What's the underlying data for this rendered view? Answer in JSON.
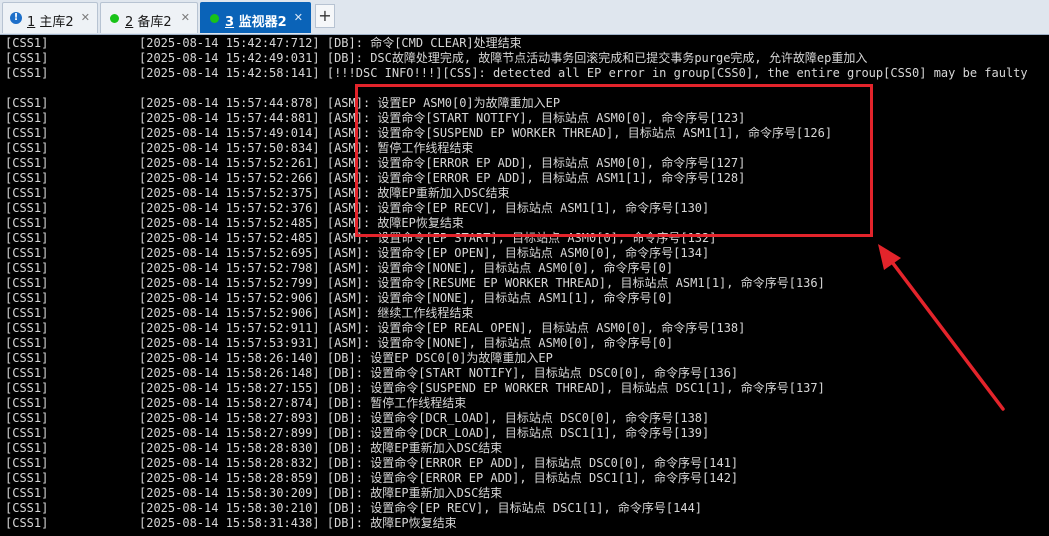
{
  "tabs": [
    {
      "number": "1",
      "title": "主库2",
      "status": "warn",
      "close": "✕"
    },
    {
      "number": "2",
      "title": "备库2",
      "status": "ok",
      "close": "✕"
    },
    {
      "number": "3",
      "title": "监视器2",
      "status": "ok",
      "close": "✕",
      "active": true
    }
  ],
  "new_tab_label": "+",
  "colors": {
    "active_tab": "#0a63b8",
    "status_ok": "#19c319",
    "annotation": "#e3242b"
  },
  "log_lines": [
    {
      "src": "[CSS1]",
      "msg": "[2025-08-14 15:42:47:712] [DB]: 命令[CMD CLEAR]处理结束"
    },
    {
      "src": "[CSS1]",
      "msg": "[2025-08-14 15:42:49:031] [DB]: DSC故障处理完成, 故障节点活动事务回滚完成和已提交事务purge完成, 允许故障ep重加入"
    },
    {
      "src": "[CSS1]",
      "msg": "[2025-08-14 15:42:58:141] [!!!DSC INFO!!!][CSS]: detected all EP error in group[CSS0], the entire group[CSS0] may be faulty"
    },
    {
      "src": "",
      "msg": ""
    },
    {
      "src": "[CSS1]",
      "msg": "[2025-08-14 15:57:44:878] [ASM]: 设置EP ASM0[0]为故障重加入EP"
    },
    {
      "src": "[CSS1]",
      "msg": "[2025-08-14 15:57:44:881] [ASM]: 设置命令[START NOTIFY], 目标站点 ASM0[0], 命令序号[123]"
    },
    {
      "src": "[CSS1]",
      "msg": "[2025-08-14 15:57:49:014] [ASM]: 设置命令[SUSPEND EP WORKER THREAD], 目标站点 ASM1[1], 命令序号[126]"
    },
    {
      "src": "[CSS1]",
      "msg": "[2025-08-14 15:57:50:834] [ASM]: 暂停工作线程结束"
    },
    {
      "src": "[CSS1]",
      "msg": "[2025-08-14 15:57:52:261] [ASM]: 设置命令[ERROR EP ADD], 目标站点 ASM0[0], 命令序号[127]"
    },
    {
      "src": "[CSS1]",
      "msg": "[2025-08-14 15:57:52:266] [ASM]: 设置命令[ERROR EP ADD], 目标站点 ASM1[1], 命令序号[128]"
    },
    {
      "src": "[CSS1]",
      "msg": "[2025-08-14 15:57:52:375] [ASM]: 故障EP重新加入DSC结束"
    },
    {
      "src": "[CSS1]",
      "msg": "[2025-08-14 15:57:52:376] [ASM]: 设置命令[EP RECV], 目标站点 ASM1[1], 命令序号[130]"
    },
    {
      "src": "[CSS1]",
      "msg": "[2025-08-14 15:57:52:485] [ASM]: 故障EP恢复结束"
    },
    {
      "src": "[CSS1]",
      "msg": "[2025-08-14 15:57:52:485] [ASM]: 设置命令[EP START], 目标站点 ASM0[0], 命令序号[132]"
    },
    {
      "src": "[CSS1]",
      "msg": "[2025-08-14 15:57:52:695] [ASM]: 设置命令[EP OPEN], 目标站点 ASM0[0], 命令序号[134]"
    },
    {
      "src": "[CSS1]",
      "msg": "[2025-08-14 15:57:52:798] [ASM]: 设置命令[NONE], 目标站点 ASM0[0], 命令序号[0]"
    },
    {
      "src": "[CSS1]",
      "msg": "[2025-08-14 15:57:52:799] [ASM]: 设置命令[RESUME EP WORKER THREAD], 目标站点 ASM1[1], 命令序号[136]"
    },
    {
      "src": "[CSS1]",
      "msg": "[2025-08-14 15:57:52:906] [ASM]: 设置命令[NONE], 目标站点 ASM1[1], 命令序号[0]"
    },
    {
      "src": "[CSS1]",
      "msg": "[2025-08-14 15:57:52:906] [ASM]: 继续工作线程结束"
    },
    {
      "src": "[CSS1]",
      "msg": "[2025-08-14 15:57:52:911] [ASM]: 设置命令[EP REAL OPEN], 目标站点 ASM0[0], 命令序号[138]"
    },
    {
      "src": "[CSS1]",
      "msg": "[2025-08-14 15:57:53:931] [ASM]: 设置命令[NONE], 目标站点 ASM0[0], 命令序号[0]"
    },
    {
      "src": "[CSS1]",
      "msg": "[2025-08-14 15:58:26:140] [DB]: 设置EP DSC0[0]为故障重加入EP"
    },
    {
      "src": "[CSS1]",
      "msg": "[2025-08-14 15:58:26:148] [DB]: 设置命令[START NOTIFY], 目标站点 DSC0[0], 命令序号[136]"
    },
    {
      "src": "[CSS1]",
      "msg": "[2025-08-14 15:58:27:155] [DB]: 设置命令[SUSPEND EP WORKER THREAD], 目标站点 DSC1[1], 命令序号[137]"
    },
    {
      "src": "[CSS1]",
      "msg": "[2025-08-14 15:58:27:874] [DB]: 暂停工作线程结束"
    },
    {
      "src": "[CSS1]",
      "msg": "[2025-08-14 15:58:27:893] [DB]: 设置命令[DCR_LOAD], 目标站点 DSC0[0], 命令序号[138]"
    },
    {
      "src": "[CSS1]",
      "msg": "[2025-08-14 15:58:27:899] [DB]: 设置命令[DCR_LOAD], 目标站点 DSC1[1], 命令序号[139]"
    },
    {
      "src": "[CSS1]",
      "msg": "[2025-08-14 15:58:28:830] [DB]: 故障EP重新加入DSC结束"
    },
    {
      "src": "[CSS1]",
      "msg": "[2025-08-14 15:58:28:832] [DB]: 设置命令[ERROR EP ADD], 目标站点 DSC0[0], 命令序号[141]"
    },
    {
      "src": "[CSS1]",
      "msg": "[2025-08-14 15:58:28:859] [DB]: 设置命令[ERROR EP ADD], 目标站点 DSC1[1], 命令序号[142]"
    },
    {
      "src": "[CSS1]",
      "msg": "[2025-08-14 15:58:30:209] [DB]: 故障EP重新加入DSC结束"
    },
    {
      "src": "[CSS1]",
      "msg": "[2025-08-14 15:58:30:210] [DB]: 设置命令[EP RECV], 目标站点 DSC1[1], 命令序号[144]"
    },
    {
      "src": "[CSS1]",
      "msg": "[2025-08-14 15:58:31:438] [DB]: 故障EP恢复结束"
    }
  ]
}
